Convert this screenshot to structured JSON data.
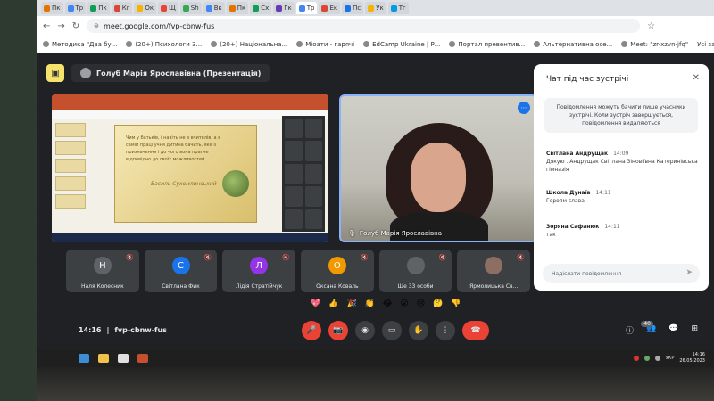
{
  "browser": {
    "tabs": [
      {
        "label": "Пк",
        "color": "#e37400"
      },
      {
        "label": "Тр",
        "color": "#4285f4"
      },
      {
        "label": "Пк",
        "color": "#0f9d58"
      },
      {
        "label": "Кг",
        "color": "#db4437"
      },
      {
        "label": "Ок",
        "color": "#f4b400"
      },
      {
        "label": "Щ",
        "color": "#ea4335"
      },
      {
        "label": "Sh",
        "color": "#34a853"
      },
      {
        "label": "Вк",
        "color": "#4285f4"
      },
      {
        "label": "Пк",
        "color": "#e37400"
      },
      {
        "label": "Сх",
        "color": "#0f9d58"
      },
      {
        "label": "Гк",
        "color": "#673ab7"
      },
      {
        "label": "Тр",
        "color": "#4285f4"
      },
      {
        "label": "Ек",
        "color": "#db4437"
      },
      {
        "label": "Пс",
        "color": "#1a73e8"
      },
      {
        "label": "Ук",
        "color": "#f4b400"
      },
      {
        "label": "Тг",
        "color": "#039be5"
      }
    ],
    "url": "meet.google.com/fvp-cbnw-fus",
    "bookmarks": [
      "Методика \"Два бу...",
      "(20+) Психологи З...",
      "(20+) Національна...",
      "Міоати - гарячі",
      "EdCamp Ukraine | Р...",
      "Портал превентив...",
      "Альтернативна осе...",
      "Meet: \"zr-xzvn-jfq\""
    ],
    "bookmarks_all": "Усі закладки"
  },
  "meet": {
    "presenter": "Голуб Марія Ярославівна (Презентація)",
    "slide": {
      "quote": "Чим у батьків, і навіть не в вчителів, а в самій праці учня дитина бачить, яке її призначення і до чого вона прагне відповідно до своїх можливостей",
      "author": "Василь Сухомлинський"
    },
    "camera_name": "Голуб Марія Ярославівна",
    "participants": [
      {
        "initial": "Н",
        "name": "Наля Колесник",
        "color": "#5f6368"
      },
      {
        "initial": "С",
        "name": "Світлана Фик",
        "color": "#1a73e8"
      },
      {
        "initial": "Л",
        "name": "Лідія Стратійчук",
        "color": "#9334e6"
      },
      {
        "initial": "О",
        "name": "Оксана Коваль",
        "color": "#f29900"
      },
      {
        "initial": "",
        "name": "Ще 33 особи",
        "color": "#5f6368"
      },
      {
        "initial": "",
        "name": "Ярмолицька Св...",
        "color": "#8d6e63"
      }
    ],
    "reactions": [
      "💖",
      "👍",
      "🎉",
      "👏",
      "😂",
      "😮",
      "😢",
      "🤔",
      "👎"
    ],
    "time": "14:16",
    "meeting_code": "fvp-cbnw-fus",
    "participant_count": "40"
  },
  "chat": {
    "title": "Чат під час зустрічі",
    "notice": "Повідомлення можуть бачити лише учасники зустрічі. Коли зустріч завершується, повідомлення видаляються",
    "messages": [
      {
        "author": "Світлана Андрущак",
        "time": "14:09",
        "text": "Дякую . Андрущак Світлана Зіновіївна Катеринівська гімназія"
      },
      {
        "author": "Школа Дунаїв",
        "time": "14:11",
        "text": "Героям слава"
      },
      {
        "author": "Зоряна Сафанюк",
        "time": "14:11",
        "text": "так"
      }
    ],
    "input_placeholder": "Надіслати повідомлення"
  },
  "taskbar": {
    "lang": "УКР",
    "clock_time": "14:16",
    "clock_date": "26.05.2023"
  }
}
